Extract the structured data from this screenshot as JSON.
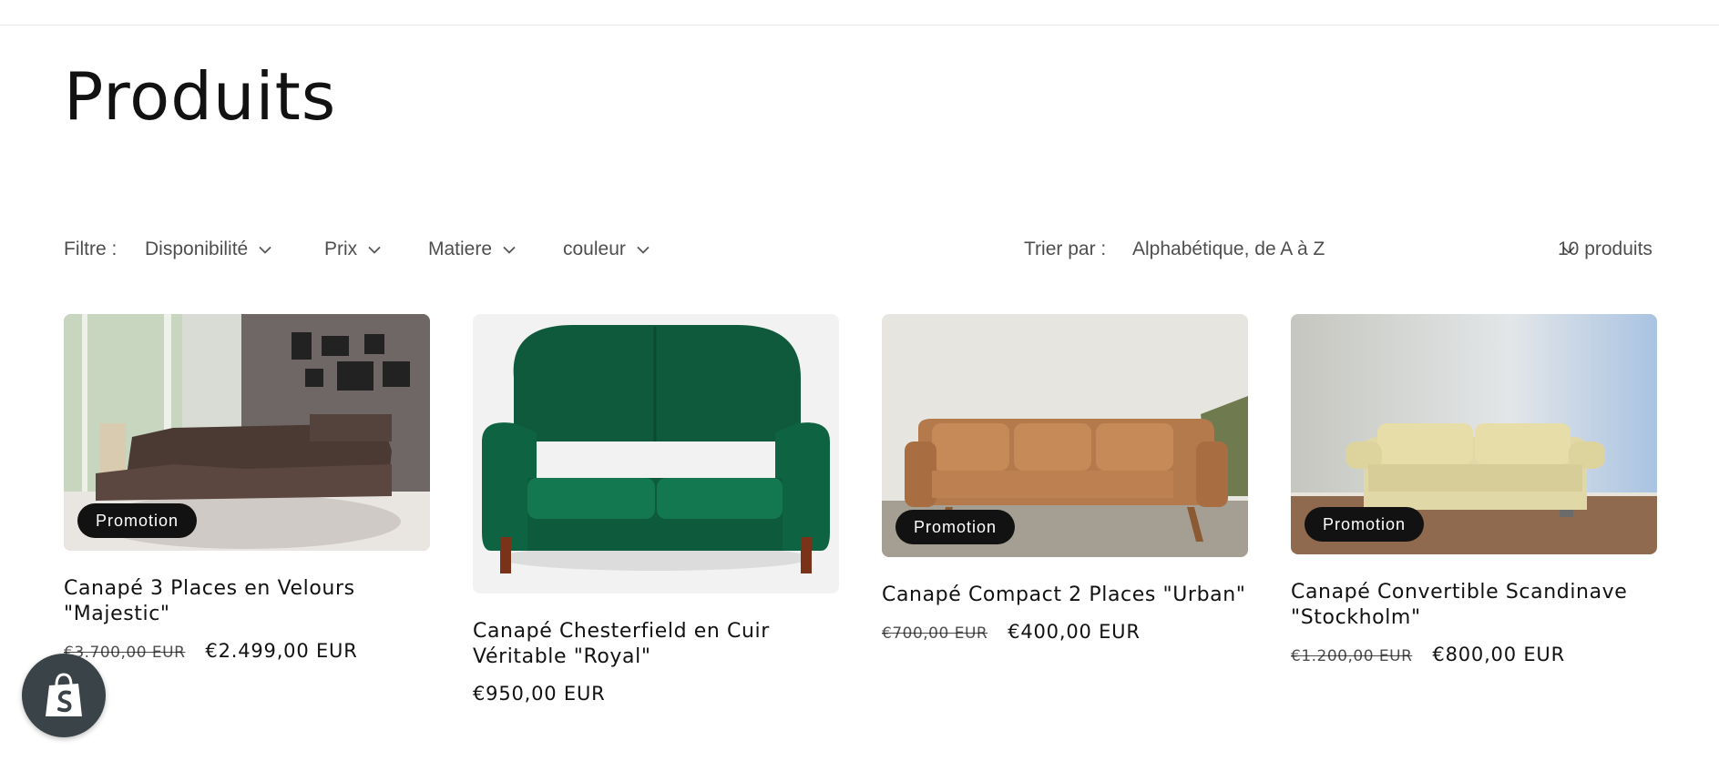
{
  "page": {
    "title": "Produits"
  },
  "filters": {
    "label": "Filtre :",
    "items": [
      {
        "label": "Disponibilité"
      },
      {
        "label": "Prix"
      },
      {
        "label": "Matiere"
      },
      {
        "label": "couleur"
      }
    ],
    "sort_label": "Trier par :",
    "sort_value": "Alphabétique, de A à Z",
    "count": "10 produits"
  },
  "products": [
    {
      "title": "Canapé 3 Places en Velours \"Majestic\"",
      "badge": "Promotion",
      "old_price": "€3.700,00 EUR",
      "price": "€2.499,00 EUR"
    },
    {
      "title": "Canapé Chesterfield en Cuir Véritable \"Royal\"",
      "badge": "",
      "old_price": "",
      "price": "€950,00 EUR"
    },
    {
      "title": "Canapé Compact 2 Places \"Urban\"",
      "badge": "Promotion",
      "old_price": "€700,00 EUR",
      "price": "€400,00 EUR"
    },
    {
      "title": "Canapé Convertible Scandinave \"Stockholm\"",
      "badge": "Promotion",
      "old_price": "€1.200,00 EUR",
      "price": "€800,00 EUR"
    }
  ],
  "icons": {
    "chevron": "chevron-down-icon",
    "shopify": "shopify-bag-icon"
  },
  "colors": {
    "badge_bg": "#121212",
    "text": "#121212",
    "shopify_button": "#3a4348"
  }
}
